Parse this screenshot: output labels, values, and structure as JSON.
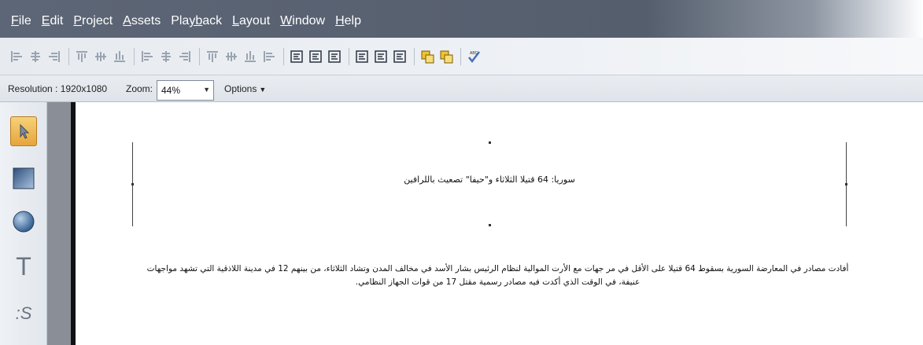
{
  "menubar": {
    "items": [
      {
        "first": "F",
        "rest": "ile"
      },
      {
        "first": "E",
        "rest": "dit"
      },
      {
        "first": "P",
        "rest": "roject"
      },
      {
        "first": "A",
        "rest": "ssets"
      },
      {
        "first": "Play",
        "rest": "back",
        "underline_second": true
      },
      {
        "first": "L",
        "rest": "ayout"
      },
      {
        "first": "W",
        "rest": "indow"
      },
      {
        "first": "H",
        "rest": "elp"
      }
    ]
  },
  "optionsbar": {
    "resolution_label": "Resolution : 1920x1080",
    "zoom_label": "Zoom:",
    "zoom_value": "44%",
    "options_label": "Options"
  },
  "toolbar": {
    "icons": [
      "align-left-icon",
      "align-center-icon",
      "align-right-icon",
      "align-top-icon",
      "align-middle-icon",
      "align-bottom-icon",
      "distribute-horizontal-icon",
      "distribute-center-icon",
      "distribute-right-icon",
      "distribute-top-icon",
      "distribute-middle-icon",
      "distribute-bottom-icon",
      "space-evenly-icon",
      "snap-left-icon",
      "snap-center-icon",
      "snap-right-icon",
      "snap-top-icon",
      "snap-middle-icon",
      "snap-bottom-icon",
      "bring-front-icon",
      "send-back-icon",
      "spellcheck-icon"
    ]
  },
  "tools": [
    "pointer-icon",
    "rectangle-icon",
    "ellipse-icon",
    "text-icon",
    "styled-text-icon"
  ],
  "canvas": {
    "headline": "سوريا: 64 قتيلا الثلاثاء و\"حيفا\" تصعيث باللرافين",
    "body_line1": "أفادت مصادر في المعارضة السورية بسقوط 64 قتيلا على الأقل في مر جهات مع الأرت الموالية لنظام الرئيس بشار الأسد في مخالف المدن وتشاد الثلاثاء، من بينهم 12 في مدينة اللاذقية التي تشهد مواجهات",
    "body_line2": "عنيفة، في الوقت الذي أكدت فيه مصادر رسمية مقتل 17 من قوات الجهاز النظامي."
  }
}
